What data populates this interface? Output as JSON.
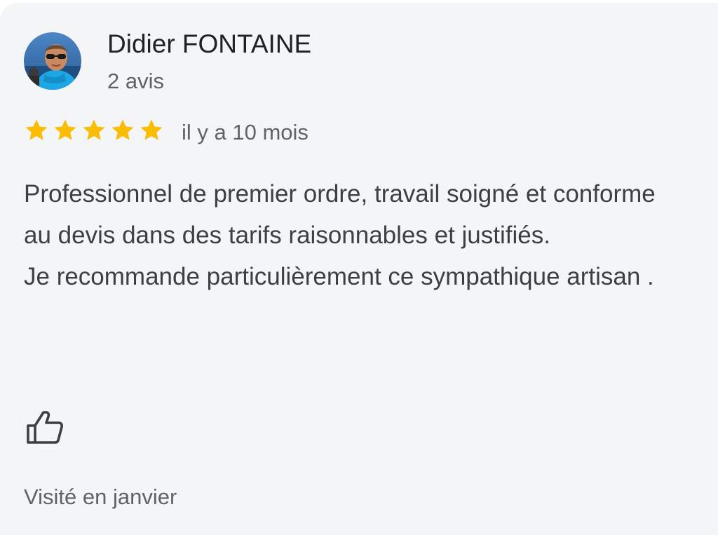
{
  "review": {
    "reviewer": {
      "name": "Didier FONTAINE",
      "review_count": "2 avis",
      "avatar_icon": "user-photo-avatar"
    },
    "rating": {
      "stars": 5,
      "max_stars": 5,
      "star_color": "#fbbc04"
    },
    "date": "il y a 10 mois",
    "text": {
      "paragraph_1": "Professionnel de premier ordre, travail soigné et conforme au devis dans des tarifs raisonnables et justifiés.",
      "paragraph_2": "Je recommande particulièrement ce sympathique artisan ."
    },
    "like_icon": "thumbs-up-icon",
    "visit": "Visité en janvier"
  },
  "colors": {
    "card_background": "#f4f5f7",
    "primary_text": "#202124",
    "secondary_text": "#5f6368",
    "body_text": "#3c4043"
  }
}
